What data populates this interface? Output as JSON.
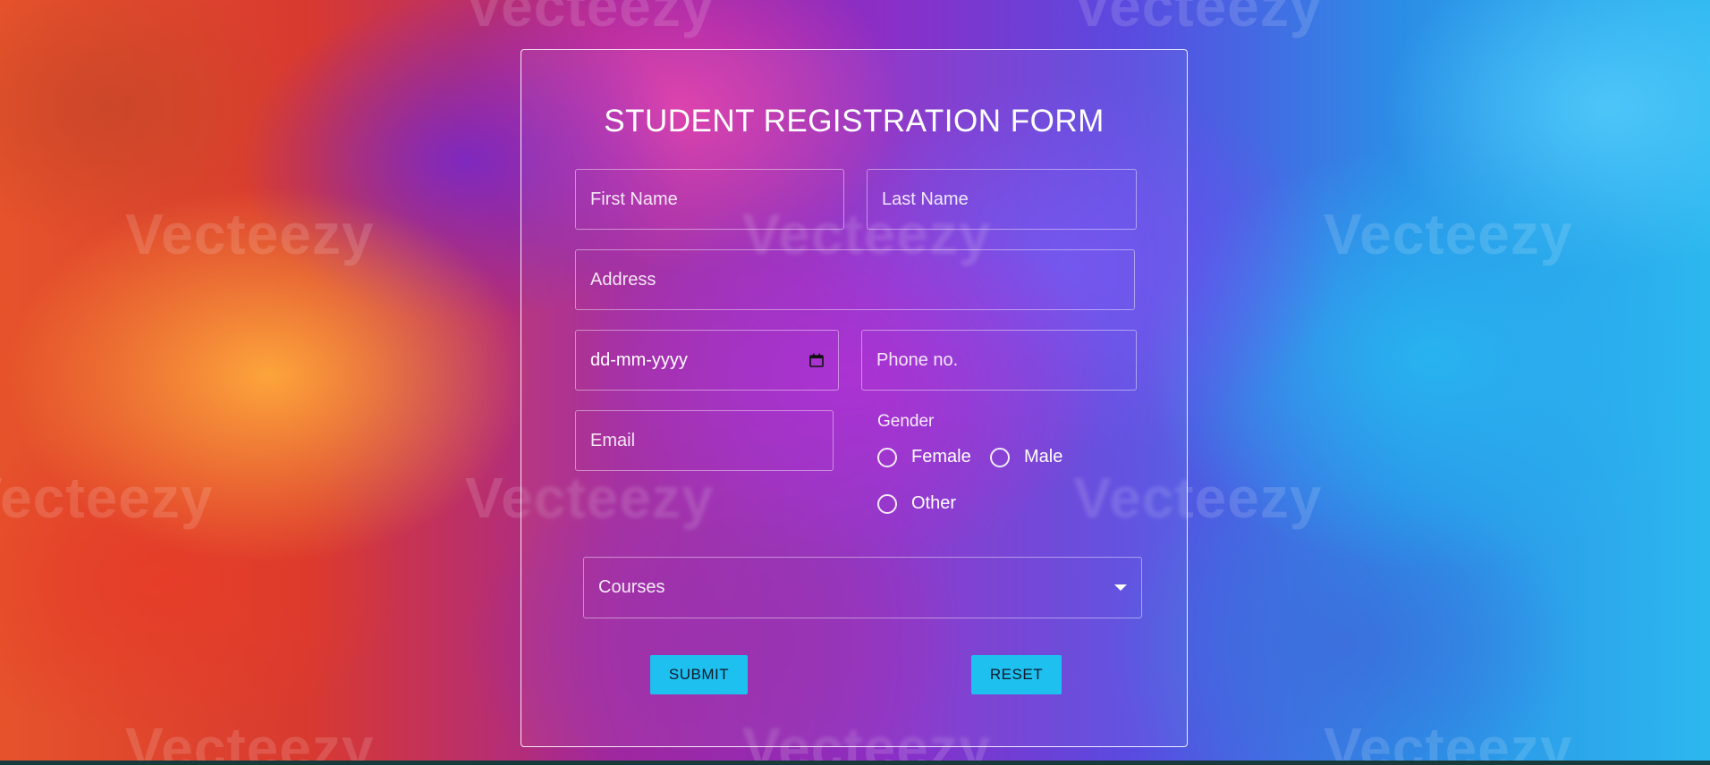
{
  "colors": {
    "accent_button": "#1ec0f0",
    "card_border": "#ffffff",
    "text": "#ffffff"
  },
  "watermark": "Vecteezy",
  "form": {
    "title": "STUDENT REGISTRATION FORM",
    "first_name_placeholder": "First Name",
    "last_name_placeholder": "Last Name",
    "address_placeholder": "Address",
    "date_placeholder": "dd-mm-yyyy",
    "phone_placeholder": "Phone no.",
    "email_placeholder": "Email",
    "gender_label": "Gender",
    "gender_options": [
      "Female",
      "Male",
      "Other"
    ],
    "courses_label": "Courses",
    "submit_label": "SUBMIT",
    "reset_label": "RESET"
  },
  "icons": {
    "date": "calendar-icon",
    "courses": "chevron-down-icon"
  }
}
